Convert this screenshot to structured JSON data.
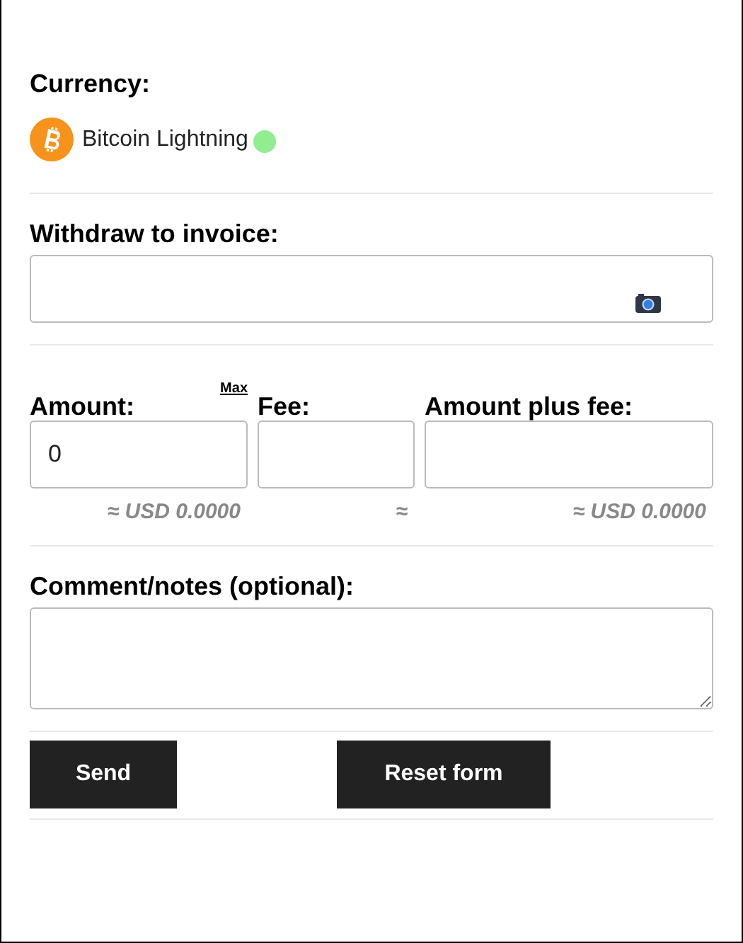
{
  "currency": {
    "label": "Currency:",
    "name": "Bitcoin Lightning",
    "online": true
  },
  "invoice": {
    "label": "Withdraw to invoice:"
  },
  "amount": {
    "label": "Amount:",
    "max_link": "Max",
    "value": "0",
    "usd": "≈ USD 0.0000"
  },
  "fee": {
    "label": "Fee:",
    "usd": "≈"
  },
  "total": {
    "label": "Amount plus fee:",
    "usd": "≈ USD 0.0000"
  },
  "comment": {
    "label": "Comment/notes (optional):"
  },
  "buttons": [
    {
      "label": "Send",
      "kind": "submit"
    },
    {
      "label": "Reset form",
      "kind": "reset"
    }
  ]
}
